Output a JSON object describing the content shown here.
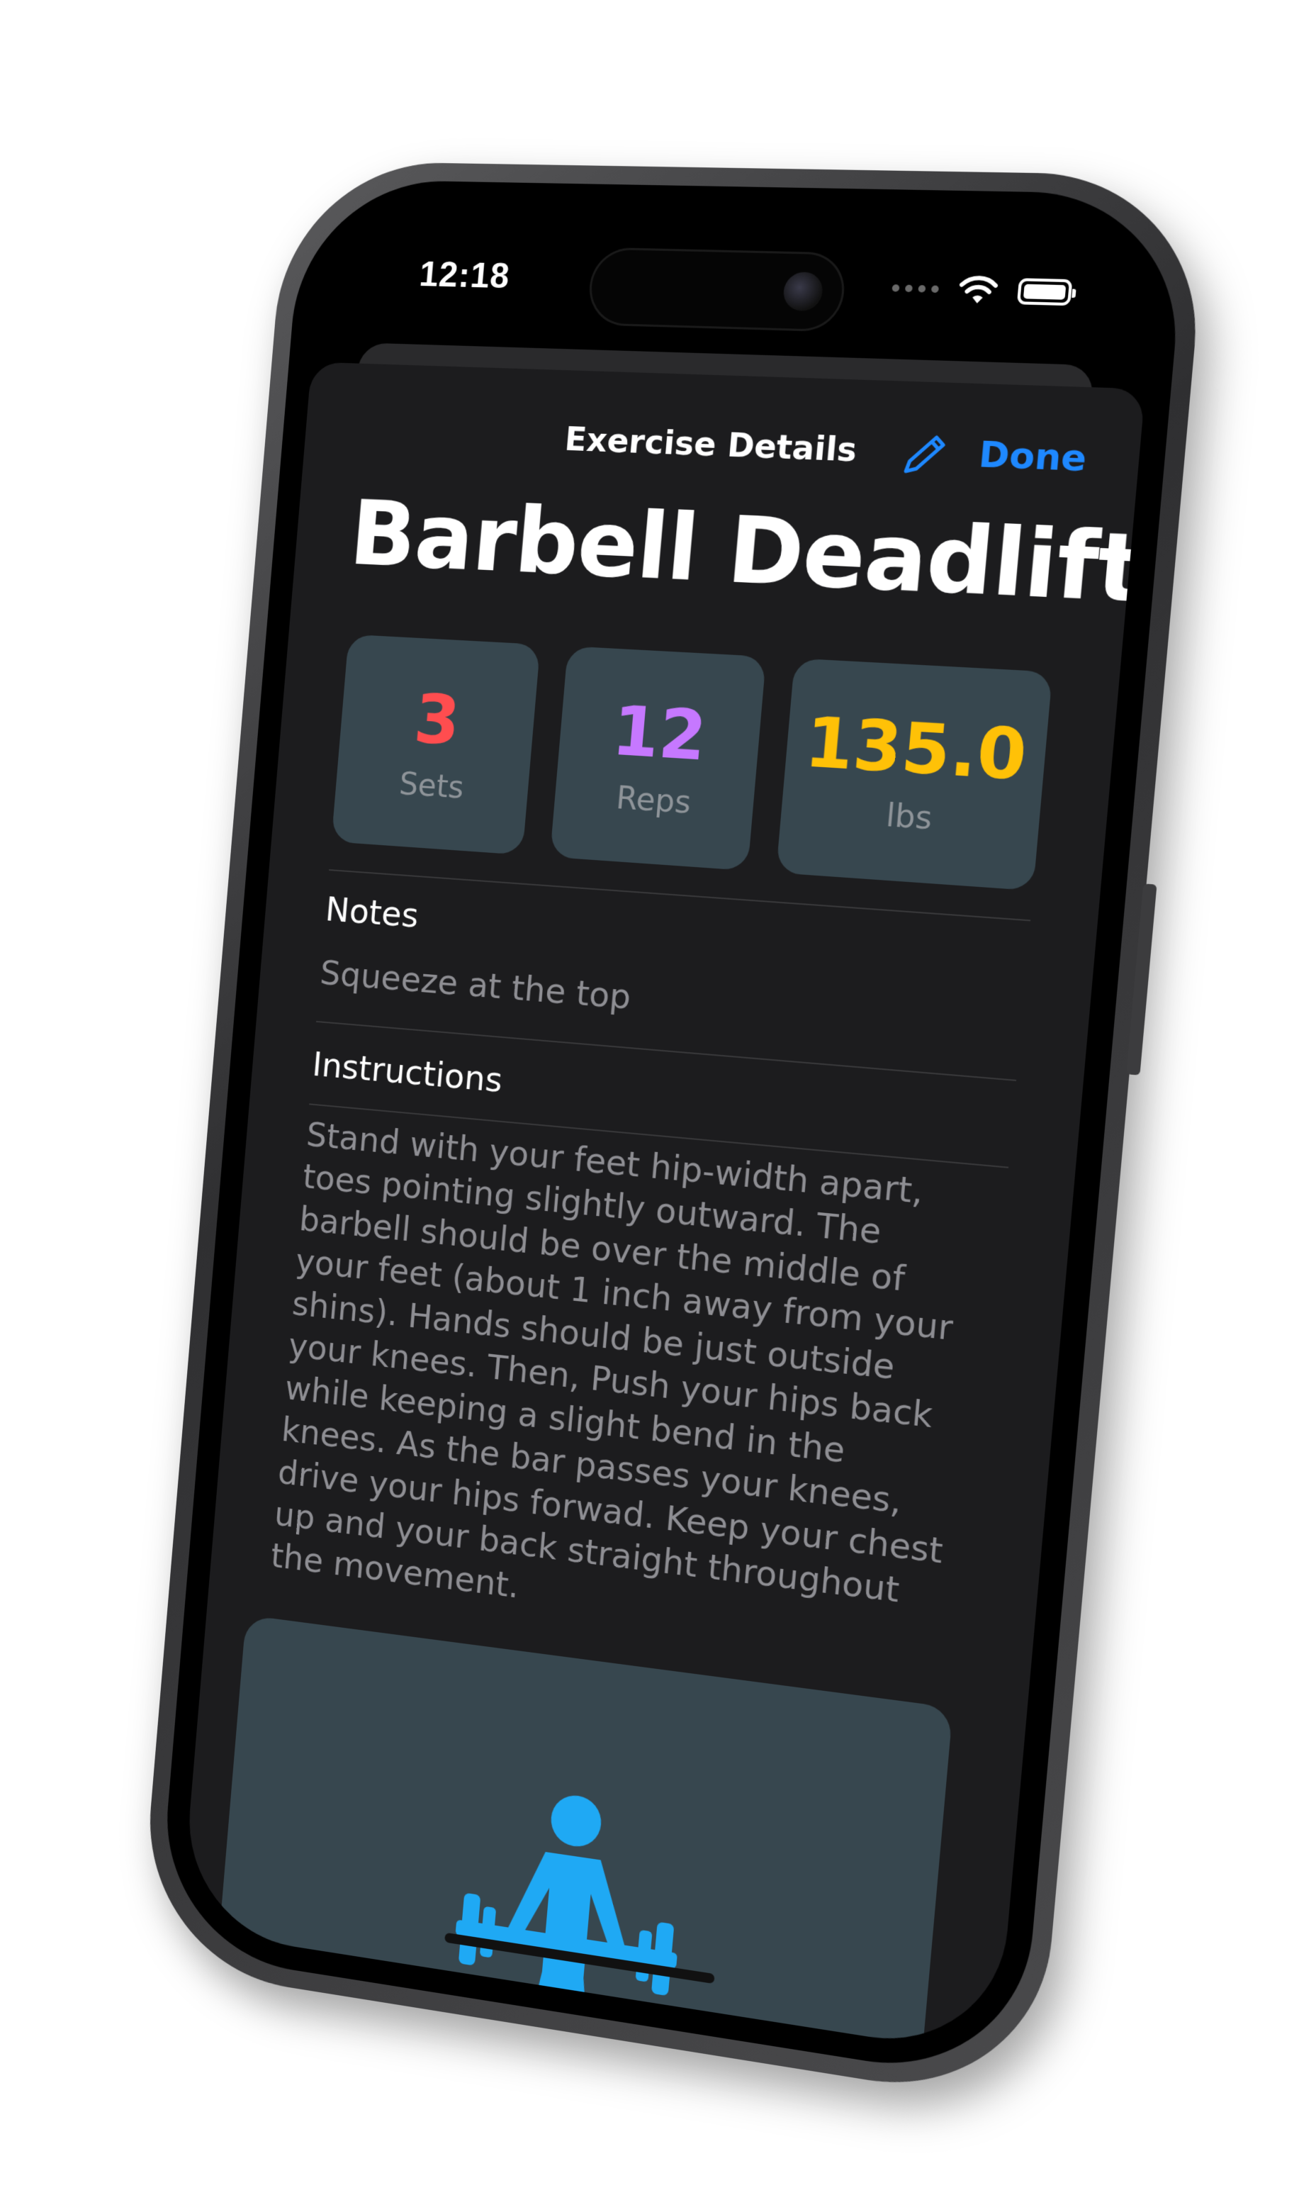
{
  "status_bar": {
    "time": "12:18",
    "wifi_icon": "wifi-icon",
    "battery_icon": "battery-icon"
  },
  "sheet": {
    "title": "Exercise Details",
    "edit_icon": "pencil-icon",
    "done_label": "Done"
  },
  "exercise": {
    "name": "Barbell Deadlift",
    "stats": [
      {
        "value": "3",
        "label": "Sets",
        "color": "#ff4d4f"
      },
      {
        "value": "12",
        "label": "Reps",
        "color": "#c678ff"
      },
      {
        "value": "135.0",
        "label": "lbs",
        "color": "#ffc107"
      }
    ],
    "notes_label": "Notes",
    "notes": "Squeeze at the top",
    "instructions_label": "Instructions",
    "instructions": "Stand with your feet hip-width apart, toes pointing slightly outward. The barbell should be over the middle of your feet (about 1 inch away from your shins). Hands should be just outside your knees. Then, Push your hips back while keeping a slight bend in the knees. As the bar passes your knees, drive your hips forwad. Keep your chest up and your back straight throughout the movement.",
    "illustration_icon": "deadlift-icon",
    "accent_color": "#1fa9f4"
  }
}
